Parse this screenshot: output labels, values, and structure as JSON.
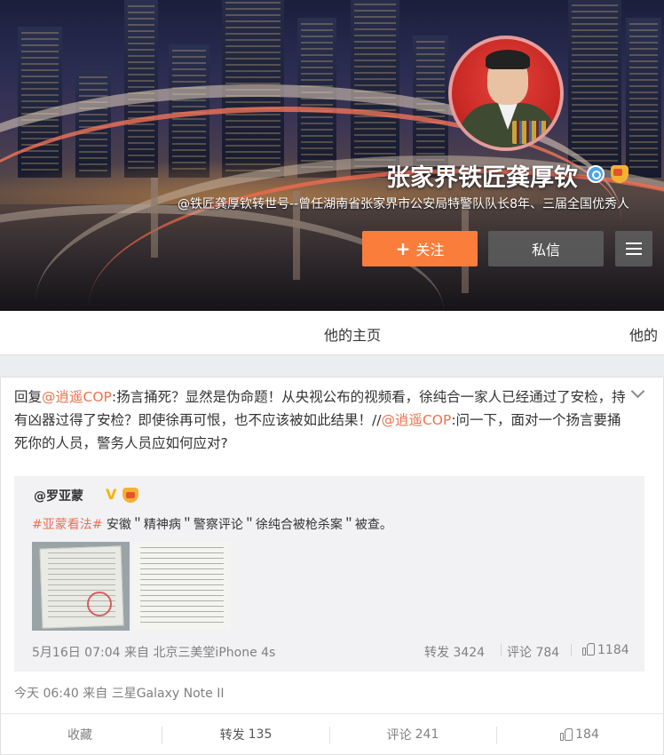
{
  "profile": {
    "name": "张家界铁匠龚厚钦",
    "description": "@铁匠龚厚钦转世号--曾任湖南省张家界市公安局特警队队长8年、三届全国优秀人",
    "follow_label": "关注",
    "message_label": "私信"
  },
  "tabs": [
    "他的主页",
    "他的​相册"
  ],
  "tab_visible": [
    "他的主页",
    "他的"
  ],
  "post": {
    "reply_prefix": "回复",
    "mention_1": "@逍遥COP",
    "reply_text_1": ":扬言捅死？显然是伪命题！从央视公布的视频看，徐纯合一家人已经通过了安检，持有凶器过得了安检？即使徐再可恨，也不应该被如此结果！//",
    "mention_2": "@逍遥COP",
    "reply_text_2": ":问一下，面对一个扬言要捅死你的人员，警务人员应如何应对?",
    "time": "今天 06:40",
    "from_label": "来自",
    "device": "三星Galaxy Note II"
  },
  "quoted": {
    "user": "@罗亚蒙",
    "topic": "#亚蒙看法#",
    "text": " 安徽＂精神病＂警察评论＂徐纯合被枪杀案＂被查。",
    "time": "5月16日 07:04",
    "from_label": "来自",
    "device": "北京三美堂iPhone 4s",
    "forward_label": "转发",
    "forward_count": "3424",
    "comment_label": "评论",
    "comment_count": "784",
    "like_count": "1184"
  },
  "actions": {
    "favorite_label": "收藏",
    "forward_label": "转发",
    "forward_count": "135",
    "comment_label": "评论",
    "comment_count": "241",
    "like_count": "184"
  },
  "colors": {
    "accent_orange": "#fa7d3c",
    "link": "#eb7350",
    "muted_text": "#808080"
  }
}
